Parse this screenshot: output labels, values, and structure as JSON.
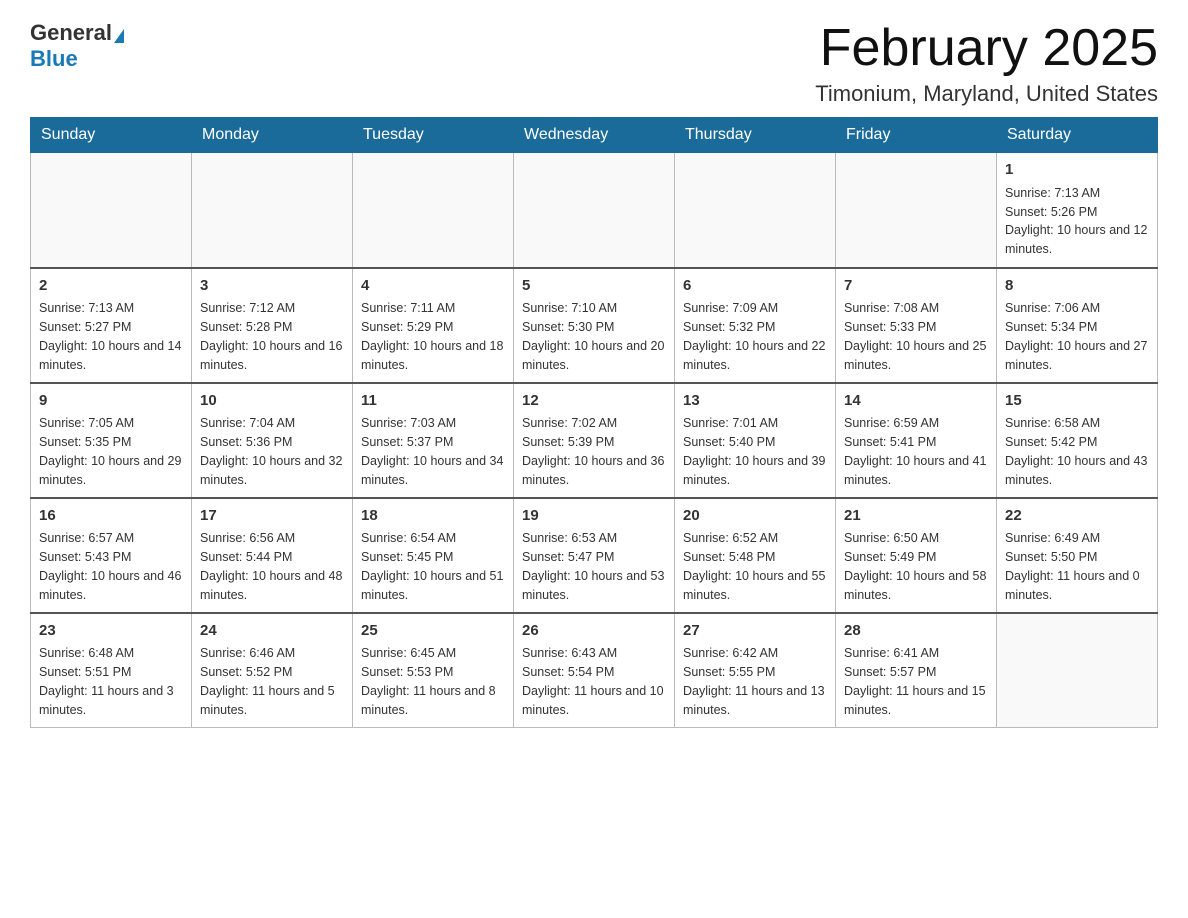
{
  "header": {
    "logo_general": "General",
    "logo_blue": "Blue",
    "month_title": "February 2025",
    "location": "Timonium, Maryland, United States"
  },
  "days_of_week": [
    "Sunday",
    "Monday",
    "Tuesday",
    "Wednesday",
    "Thursday",
    "Friday",
    "Saturday"
  ],
  "weeks": [
    [
      {
        "day": "",
        "info": ""
      },
      {
        "day": "",
        "info": ""
      },
      {
        "day": "",
        "info": ""
      },
      {
        "day": "",
        "info": ""
      },
      {
        "day": "",
        "info": ""
      },
      {
        "day": "",
        "info": ""
      },
      {
        "day": "1",
        "info": "Sunrise: 7:13 AM\nSunset: 5:26 PM\nDaylight: 10 hours and 12 minutes."
      }
    ],
    [
      {
        "day": "2",
        "info": "Sunrise: 7:13 AM\nSunset: 5:27 PM\nDaylight: 10 hours and 14 minutes."
      },
      {
        "day": "3",
        "info": "Sunrise: 7:12 AM\nSunset: 5:28 PM\nDaylight: 10 hours and 16 minutes."
      },
      {
        "day": "4",
        "info": "Sunrise: 7:11 AM\nSunset: 5:29 PM\nDaylight: 10 hours and 18 minutes."
      },
      {
        "day": "5",
        "info": "Sunrise: 7:10 AM\nSunset: 5:30 PM\nDaylight: 10 hours and 20 minutes."
      },
      {
        "day": "6",
        "info": "Sunrise: 7:09 AM\nSunset: 5:32 PM\nDaylight: 10 hours and 22 minutes."
      },
      {
        "day": "7",
        "info": "Sunrise: 7:08 AM\nSunset: 5:33 PM\nDaylight: 10 hours and 25 minutes."
      },
      {
        "day": "8",
        "info": "Sunrise: 7:06 AM\nSunset: 5:34 PM\nDaylight: 10 hours and 27 minutes."
      }
    ],
    [
      {
        "day": "9",
        "info": "Sunrise: 7:05 AM\nSunset: 5:35 PM\nDaylight: 10 hours and 29 minutes."
      },
      {
        "day": "10",
        "info": "Sunrise: 7:04 AM\nSunset: 5:36 PM\nDaylight: 10 hours and 32 minutes."
      },
      {
        "day": "11",
        "info": "Sunrise: 7:03 AM\nSunset: 5:37 PM\nDaylight: 10 hours and 34 minutes."
      },
      {
        "day": "12",
        "info": "Sunrise: 7:02 AM\nSunset: 5:39 PM\nDaylight: 10 hours and 36 minutes."
      },
      {
        "day": "13",
        "info": "Sunrise: 7:01 AM\nSunset: 5:40 PM\nDaylight: 10 hours and 39 minutes."
      },
      {
        "day": "14",
        "info": "Sunrise: 6:59 AM\nSunset: 5:41 PM\nDaylight: 10 hours and 41 minutes."
      },
      {
        "day": "15",
        "info": "Sunrise: 6:58 AM\nSunset: 5:42 PM\nDaylight: 10 hours and 43 minutes."
      }
    ],
    [
      {
        "day": "16",
        "info": "Sunrise: 6:57 AM\nSunset: 5:43 PM\nDaylight: 10 hours and 46 minutes."
      },
      {
        "day": "17",
        "info": "Sunrise: 6:56 AM\nSunset: 5:44 PM\nDaylight: 10 hours and 48 minutes."
      },
      {
        "day": "18",
        "info": "Sunrise: 6:54 AM\nSunset: 5:45 PM\nDaylight: 10 hours and 51 minutes."
      },
      {
        "day": "19",
        "info": "Sunrise: 6:53 AM\nSunset: 5:47 PM\nDaylight: 10 hours and 53 minutes."
      },
      {
        "day": "20",
        "info": "Sunrise: 6:52 AM\nSunset: 5:48 PM\nDaylight: 10 hours and 55 minutes."
      },
      {
        "day": "21",
        "info": "Sunrise: 6:50 AM\nSunset: 5:49 PM\nDaylight: 10 hours and 58 minutes."
      },
      {
        "day": "22",
        "info": "Sunrise: 6:49 AM\nSunset: 5:50 PM\nDaylight: 11 hours and 0 minutes."
      }
    ],
    [
      {
        "day": "23",
        "info": "Sunrise: 6:48 AM\nSunset: 5:51 PM\nDaylight: 11 hours and 3 minutes."
      },
      {
        "day": "24",
        "info": "Sunrise: 6:46 AM\nSunset: 5:52 PM\nDaylight: 11 hours and 5 minutes."
      },
      {
        "day": "25",
        "info": "Sunrise: 6:45 AM\nSunset: 5:53 PM\nDaylight: 11 hours and 8 minutes."
      },
      {
        "day": "26",
        "info": "Sunrise: 6:43 AM\nSunset: 5:54 PM\nDaylight: 11 hours and 10 minutes."
      },
      {
        "day": "27",
        "info": "Sunrise: 6:42 AM\nSunset: 5:55 PM\nDaylight: 11 hours and 13 minutes."
      },
      {
        "day": "28",
        "info": "Sunrise: 6:41 AM\nSunset: 5:57 PM\nDaylight: 11 hours and 15 minutes."
      },
      {
        "day": "",
        "info": ""
      }
    ]
  ]
}
